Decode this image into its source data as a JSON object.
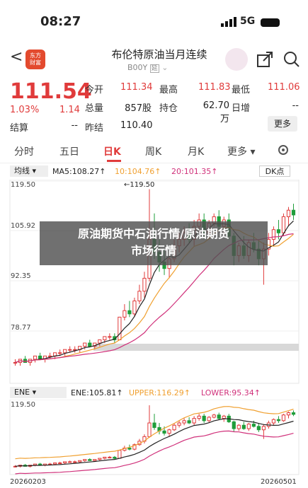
{
  "status": {
    "time": "08:27",
    "network": "5G"
  },
  "header": {
    "title": "布伦特原油当月连续",
    "code": "B00Y",
    "code_badge": "延",
    "logo_text_1": "东方",
    "logo_text_2": "财富"
  },
  "quote": {
    "price": "111.54",
    "change_pct": "1.03%",
    "change": "1.14",
    "fields": [
      {
        "label": "今开",
        "value": "111.34",
        "color": "red"
      },
      {
        "label": "最高",
        "value": "111.83",
        "color": "red"
      },
      {
        "label": "最低",
        "value": "111.06",
        "color": "red"
      },
      {
        "label": "总量",
        "value": "857股",
        "color": "dk"
      },
      {
        "label": "持仓",
        "value": "62.70万",
        "color": "dk"
      },
      {
        "label": "日增",
        "value": "--",
        "color": "dk"
      },
      {
        "label": "结算",
        "value": "--",
        "color": "dk"
      },
      {
        "label": "昨结",
        "value": "110.40",
        "color": "dk"
      }
    ],
    "more_label": "更多"
  },
  "tabs": [
    "分时",
    "五日",
    "日K",
    "周K",
    "月K",
    "更多"
  ],
  "active_tab": "日K",
  "indicators": {
    "main_selector": "均线",
    "ma5": "MA5:108.27↑",
    "ma10": "10:104.76↑",
    "ma20": "20:101.35↑",
    "dk_label": "DK点",
    "peak_label": "←119.50",
    "ene_selector": "ENE",
    "ene": "ENE:105.81↑",
    "upper": "UPPER:116.29↑",
    "lower": "LOWER:95.34↑"
  },
  "y_axis": [
    "119.50",
    "105.92",
    "92.35",
    "78.77"
  ],
  "y_axis2": [
    "119.50"
  ],
  "dates": [
    "20260203",
    "20260501"
  ],
  "overlay": {
    "line1": "原油期货中石油行情/原油期货",
    "line2": "市场行情"
  },
  "colors": {
    "up": "#e03b3b",
    "down": "#1f9d3a",
    "ma5": "#222222",
    "ma10": "#f0a030",
    "ma20": "#d0307a",
    "ene": "#222222",
    "upper": "#f0a030",
    "lower": "#d0307a"
  },
  "chart_data": {
    "type": "candlestick",
    "ohlc": [
      [
        66,
        67,
        65,
        66
      ],
      [
        66,
        67,
        65,
        67
      ],
      [
        67,
        68,
        66,
        66
      ],
      [
        66,
        67,
        65,
        67
      ],
      [
        67,
        68,
        66,
        68
      ],
      [
        68,
        69,
        67,
        67
      ],
      [
        67,
        68,
        66,
        68
      ],
      [
        68,
        69,
        67,
        68
      ],
      [
        68,
        69,
        67,
        69
      ],
      [
        69,
        70,
        68,
        69
      ],
      [
        69,
        70,
        68,
        70
      ],
      [
        70,
        71,
        69,
        70
      ],
      [
        70,
        71,
        69,
        70
      ],
      [
        70,
        71,
        69,
        71
      ],
      [
        71,
        72,
        70,
        72
      ],
      [
        72,
        73,
        71,
        71
      ],
      [
        71,
        72,
        70,
        72
      ],
      [
        72,
        73,
        71,
        73
      ],
      [
        73,
        74,
        72,
        74
      ],
      [
        74,
        75,
        73,
        74
      ],
      [
        74,
        75,
        72,
        73
      ],
      [
        73,
        80,
        73,
        80
      ],
      [
        80,
        84,
        79,
        82
      ],
      [
        82,
        85,
        80,
        81
      ],
      [
        81,
        86,
        80,
        85
      ],
      [
        85,
        90,
        84,
        88
      ],
      [
        88,
        94,
        86,
        92
      ],
      [
        92,
        119.5,
        91,
        104
      ],
      [
        104,
        112,
        98,
        100
      ],
      [
        100,
        104,
        94,
        97
      ],
      [
        97,
        101,
        93,
        95
      ],
      [
        95,
        99,
        92,
        98
      ],
      [
        98,
        104,
        97,
        102
      ],
      [
        102,
        106,
        100,
        104
      ],
      [
        104,
        108,
        102,
        106
      ],
      [
        106,
        109,
        103,
        104
      ],
      [
        104,
        110,
        102,
        108
      ],
      [
        108,
        112,
        106,
        110
      ],
      [
        110,
        112,
        104,
        106
      ],
      [
        106,
        110,
        104,
        109
      ],
      [
        109,
        112,
        108,
        111
      ],
      [
        111,
        113,
        107,
        108
      ],
      [
        108,
        111,
        105,
        110
      ],
      [
        110,
        112,
        104,
        105
      ],
      [
        105,
        106,
        96,
        99
      ],
      [
        99,
        103,
        97,
        102
      ],
      [
        102,
        105,
        98,
        99
      ],
      [
        99,
        104,
        97,
        103
      ],
      [
        103,
        106,
        100,
        101
      ],
      [
        101,
        104,
        96,
        98
      ],
      [
        98,
        103,
        90,
        101
      ],
      [
        101,
        106,
        99,
        104
      ],
      [
        104,
        108,
        102,
        107
      ],
      [
        107,
        110,
        104,
        106
      ],
      [
        106,
        112,
        105,
        111
      ],
      [
        111,
        114,
        108,
        113
      ],
      [
        113,
        115,
        110,
        111.54
      ]
    ]
  }
}
